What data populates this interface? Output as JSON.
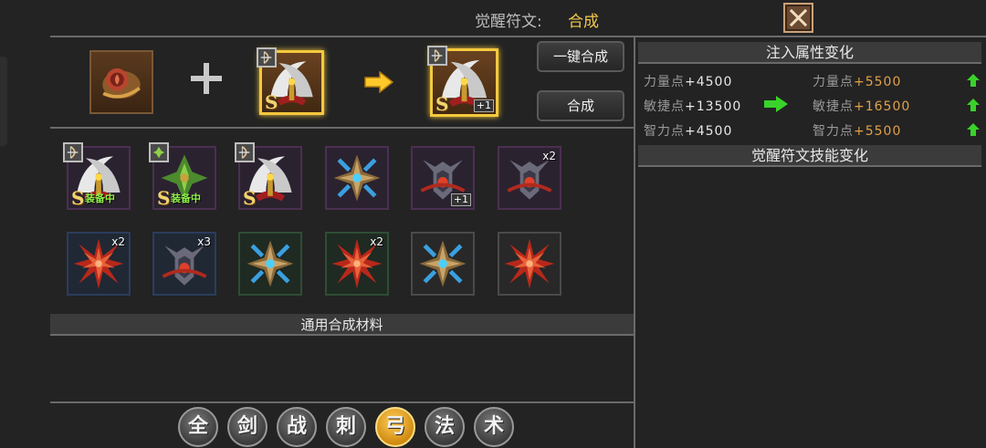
{
  "header": {
    "title": "觉醒符文:",
    "mode": "合成"
  },
  "buttons": {
    "one_click_label": "一键合成",
    "synth_label": "合成"
  },
  "synthesis": {
    "main_item": {
      "grade": "S"
    },
    "result_item": {
      "grade": "S",
      "plus": "+1"
    }
  },
  "inventory": {
    "row1": [
      {
        "grade": "S",
        "tag": "装备中"
      },
      {
        "grade": "S",
        "tag": "装备中"
      },
      {
        "grade": "S"
      },
      {},
      {
        "plus": "+1"
      },
      {
        "count": "x2"
      }
    ],
    "row2": [
      {
        "count": "x2"
      },
      {
        "count": "x3"
      },
      {},
      {
        "count": "x2"
      },
      {},
      {}
    ]
  },
  "materials_section": {
    "title": "通用合成材料"
  },
  "filters": [
    "全",
    "剑",
    "战",
    "刺",
    "弓",
    "法",
    "术"
  ],
  "active_filter": "弓",
  "right_panel": {
    "inject_title": "注入属性变化",
    "stats": [
      {
        "label": "力量点",
        "old": "+4500",
        "new": "+5500"
      },
      {
        "label": "敏捷点",
        "old": "+13500",
        "new": "+16500"
      },
      {
        "label": "智力点",
        "old": "+4500",
        "new": "+5500"
      }
    ],
    "skill_title": "觉醒符文技能变化"
  },
  "colors": {
    "accent_gold": "#f2c94c",
    "increase_green": "#3ad22a",
    "new_value_orange": "#e0a14b"
  }
}
